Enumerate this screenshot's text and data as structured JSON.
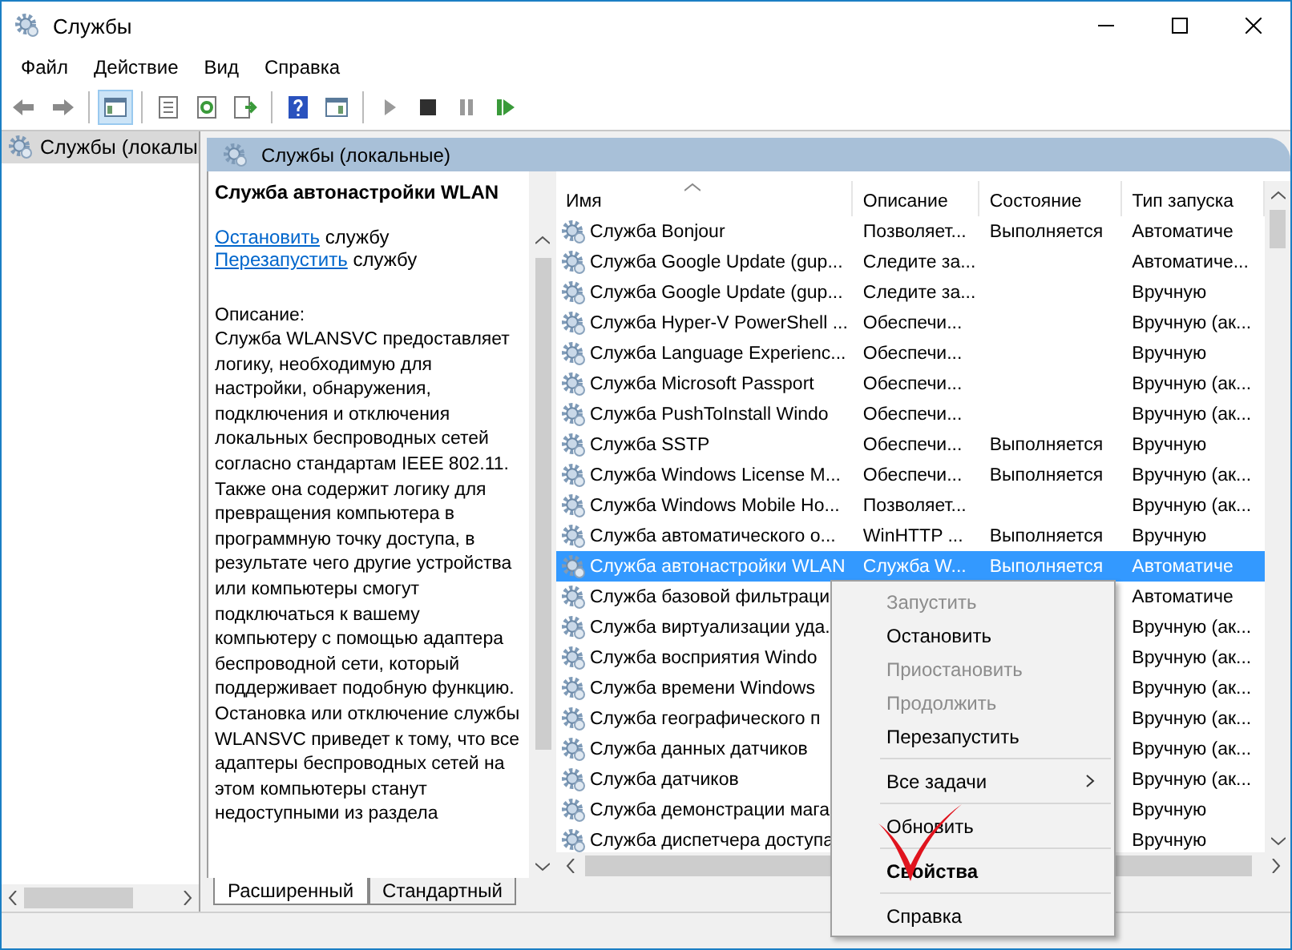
{
  "window": {
    "title": "Службы"
  },
  "menu": [
    "Файл",
    "Действие",
    "Вид",
    "Справка"
  ],
  "toolbar": [
    {
      "kind": "back",
      "selected": false
    },
    {
      "kind": "forward",
      "selected": false
    },
    {
      "kind": "sep"
    },
    {
      "kind": "tree",
      "selected": true
    },
    {
      "kind": "sep"
    },
    {
      "kind": "list",
      "selected": false
    },
    {
      "kind": "refresh",
      "selected": false
    },
    {
      "kind": "export",
      "selected": false
    },
    {
      "kind": "sep"
    },
    {
      "kind": "help",
      "selected": false
    },
    {
      "kind": "view",
      "selected": false
    },
    {
      "kind": "sep"
    },
    {
      "kind": "play",
      "selected": false,
      "disabled": true
    },
    {
      "kind": "stop",
      "selected": false,
      "disabled": false
    },
    {
      "kind": "pause",
      "selected": false,
      "disabled": true
    },
    {
      "kind": "resume",
      "selected": false,
      "disabled": false
    }
  ],
  "tree": {
    "items": [
      {
        "label": "Службы (локалы",
        "selected": true
      }
    ]
  },
  "panel": {
    "title": "Службы (локальные)"
  },
  "details": {
    "title": "Служба автонастройки WLAN",
    "actions": [
      {
        "link": "Остановить",
        "text": "службу"
      },
      {
        "link": "Перезапустить",
        "text": "службу"
      }
    ],
    "description_label": "Описание:",
    "description": "Служба WLANSVC предоставляет логику, необходимую для настройки, обнаружения, подключения и отключения локальных беспроводных сетей согласно стандартам IEEE 802.11. Также она содержит логику для превращения компьютера в программную точку доступа, в результате чего другие устройства или компьютеры смогут подключаться к вашему компьютеру с помощью адаптера беспроводной сети, который поддерживает подобную функцию. Остановка или отключение службы WLANSVC приведет к тому, что все адаптеры беспроводных сетей на этом компьютеры станут недоступными из раздела"
  },
  "table": {
    "columns": [
      {
        "label": "Имя",
        "sorted": true
      },
      {
        "label": "Описание",
        "sorted": false
      },
      {
        "label": "Состояние",
        "sorted": false
      },
      {
        "label": "Тип запуска",
        "sorted": false
      }
    ],
    "rows": [
      {
        "name": "Служба Bonjour",
        "description": "Позволяет...",
        "status": "Выполняется",
        "startup": "Автоматиче",
        "selected": false
      },
      {
        "name": "Служба Google Update (gup...",
        "description": "Следите за...",
        "startup": "Автоматиче...",
        "selected": false
      },
      {
        "name": "Служба Google Update (gup...",
        "description": "Следите за...",
        "startup": "Вручную",
        "selected": false
      },
      {
        "name": "Служба Hyper-V PowerShell ...",
        "description": "Обеспечи...",
        "startup": "Вручную (ак...",
        "selected": false
      },
      {
        "name": "Служба Language Experienc...",
        "description": "Обеспечи...",
        "startup": "Вручную",
        "selected": false
      },
      {
        "name": "Служба Microsoft Passport",
        "description": "Обеспечи...",
        "startup": "Вручную (ак...",
        "selected": false
      },
      {
        "name": "Служба PushToInstall Windo",
        "description": "Обеспечи...",
        "startup": "Вручную (ак...",
        "selected": false
      },
      {
        "name": "Служба SSTP",
        "description": "Обеспечи...",
        "status": "Выполняется",
        "startup": "Вручную",
        "selected": false
      },
      {
        "name": "Служба Windows License M...",
        "description": "Обеспечи...",
        "status": "Выполняется",
        "startup": "Вручную (ак...",
        "selected": false
      },
      {
        "name": "Служба Windows Mobile Ho...",
        "description": "Позволяет...",
        "startup": "Вручную (ак...",
        "selected": false
      },
      {
        "name": "Служба автоматического о...",
        "description": "WinHTTP ...",
        "status": "Выполняется",
        "startup": "Вручную",
        "selected": false
      },
      {
        "name": "Служба автонастройки WLAN",
        "description": "Служба W...",
        "status": "Выполняется",
        "startup": "Автоматиче",
        "selected": true
      },
      {
        "name": "Служба базовой фильтраци",
        "startup": "Автоматиче",
        "selected": false
      },
      {
        "name": "Служба виртуализации уда.",
        "startup": "Вручную (ак...",
        "selected": false
      },
      {
        "name": "Служба восприятия Windo",
        "startup": "Вручную (ак...",
        "selected": false
      },
      {
        "name": "Служба времени Windows",
        "startup": "Вручную (ак...",
        "selected": false
      },
      {
        "name": "Служба географического п",
        "startup": "Вручную (ак...",
        "selected": false
      },
      {
        "name": "Служба данных датчиков",
        "startup": "Вручную (ак...",
        "selected": false
      },
      {
        "name": "Служба датчиков",
        "startup": "Вручную (ак...",
        "selected": false
      },
      {
        "name": "Служба демонстрации мага",
        "startup": "Вручную",
        "selected": false
      },
      {
        "name": "Служба диспетчера доступа",
        "startup": "Вручную",
        "selected": false
      }
    ]
  },
  "tabs": [
    {
      "label": "Расширенный",
      "selected": true
    },
    {
      "label": "Стандартный",
      "selected": false
    }
  ],
  "context_menu": {
    "items": [
      {
        "kind": "item",
        "label": "Запустить",
        "disabled": true,
        "bold": false
      },
      {
        "kind": "item",
        "label": "Остановить",
        "disabled": false,
        "bold": false
      },
      {
        "kind": "item",
        "label": "Приостановить",
        "disabled": true,
        "bold": false
      },
      {
        "kind": "item",
        "label": "Продолжить",
        "disabled": true,
        "bold": false
      },
      {
        "kind": "item",
        "label": "Перезапустить",
        "disabled": false,
        "bold": false
      },
      {
        "kind": "separator"
      },
      {
        "kind": "submenu",
        "label": "Все задачи",
        "disabled": false,
        "bold": false
      },
      {
        "kind": "separator"
      },
      {
        "kind": "item",
        "label": "Обновить",
        "disabled": false,
        "bold": false
      },
      {
        "kind": "separator"
      },
      {
        "kind": "item",
        "label": "Свойства",
        "disabled": false,
        "bold": true
      },
      {
        "kind": "separator"
      },
      {
        "kind": "item",
        "label": "Справка",
        "disabled": false,
        "bold": false
      }
    ]
  }
}
